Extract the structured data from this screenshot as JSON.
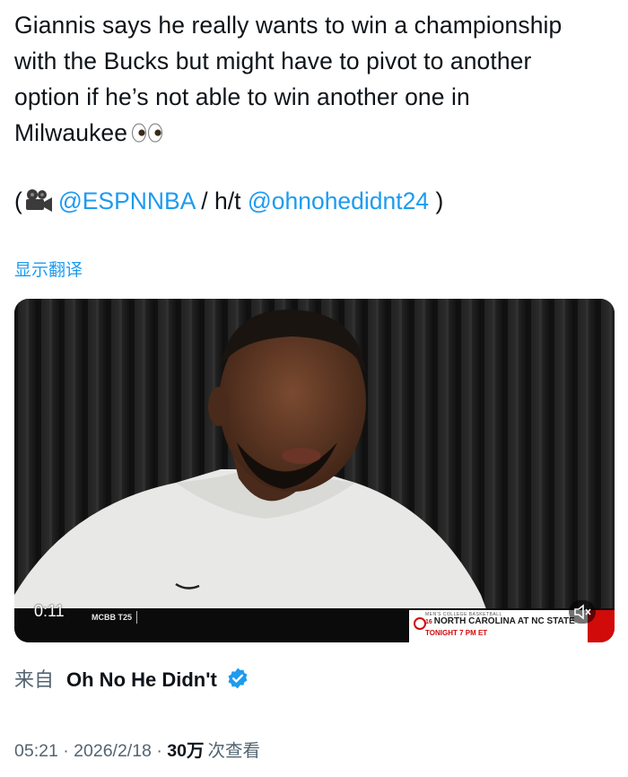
{
  "tweet": {
    "text_lines": [
      "Giannis says he really wants to win a championship",
      "with the Bucks but might have to pivot to another",
      "option if he’s not able to win another one in",
      "Milwaukee"
    ],
    "credit": {
      "open": "(",
      "mention1": "@ESPNNBA",
      "separator": " / h/t ",
      "mention2": "@ohnohedidnt24",
      "close": " )"
    },
    "translate_label": "显示翻译"
  },
  "video": {
    "timecode": "0:11",
    "ticker_label": "MCBB T25",
    "ad": {
      "small": "MEN'S COLLEGE BASKETBALL",
      "rank": "16",
      "matchup": "NORTH CAROLINA AT NC STATE",
      "time": "TONIGHT 7 PM ET"
    },
    "muted": true
  },
  "source": {
    "from_label": "来自",
    "name": "Oh No He Didn't",
    "verified": true
  },
  "meta": {
    "time": "05:21",
    "dot1": " · ",
    "date": "2026/2/18",
    "dot2": " · ",
    "views_count": "30万",
    "views_label": "次查看"
  },
  "colors": {
    "link": "#1d9bf0",
    "text": "#0f1419",
    "secondary": "#536471",
    "espn_red": "#d10a0a"
  }
}
